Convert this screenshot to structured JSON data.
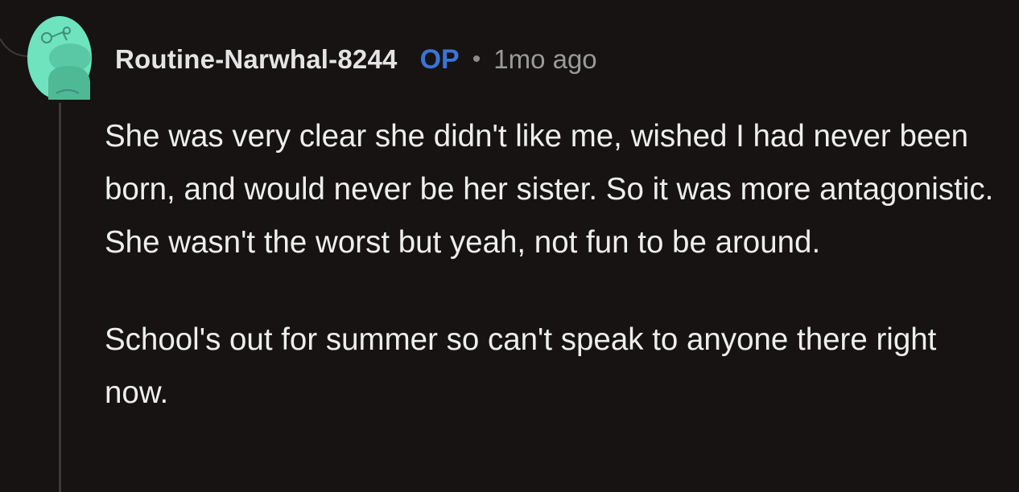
{
  "comment": {
    "username": "Routine-Narwhal-8244",
    "op_badge": "OP",
    "separator": "•",
    "timestamp": "1mo ago",
    "avatar_icon": "snoo-avatar-icon",
    "paragraphs": [
      "She was very clear she didn't like me, wished I had never been born, and would never be her sister. So it was more antagonistic. She wasn't the worst but yeah, not fun to be around.",
      "School's out for summer so can't speak to anyone there right now."
    ]
  },
  "colors": {
    "background": "#161312",
    "avatar": "#6fe3bd",
    "op_badge": "#3a74d8",
    "thread_line": "#3a3a3a"
  }
}
